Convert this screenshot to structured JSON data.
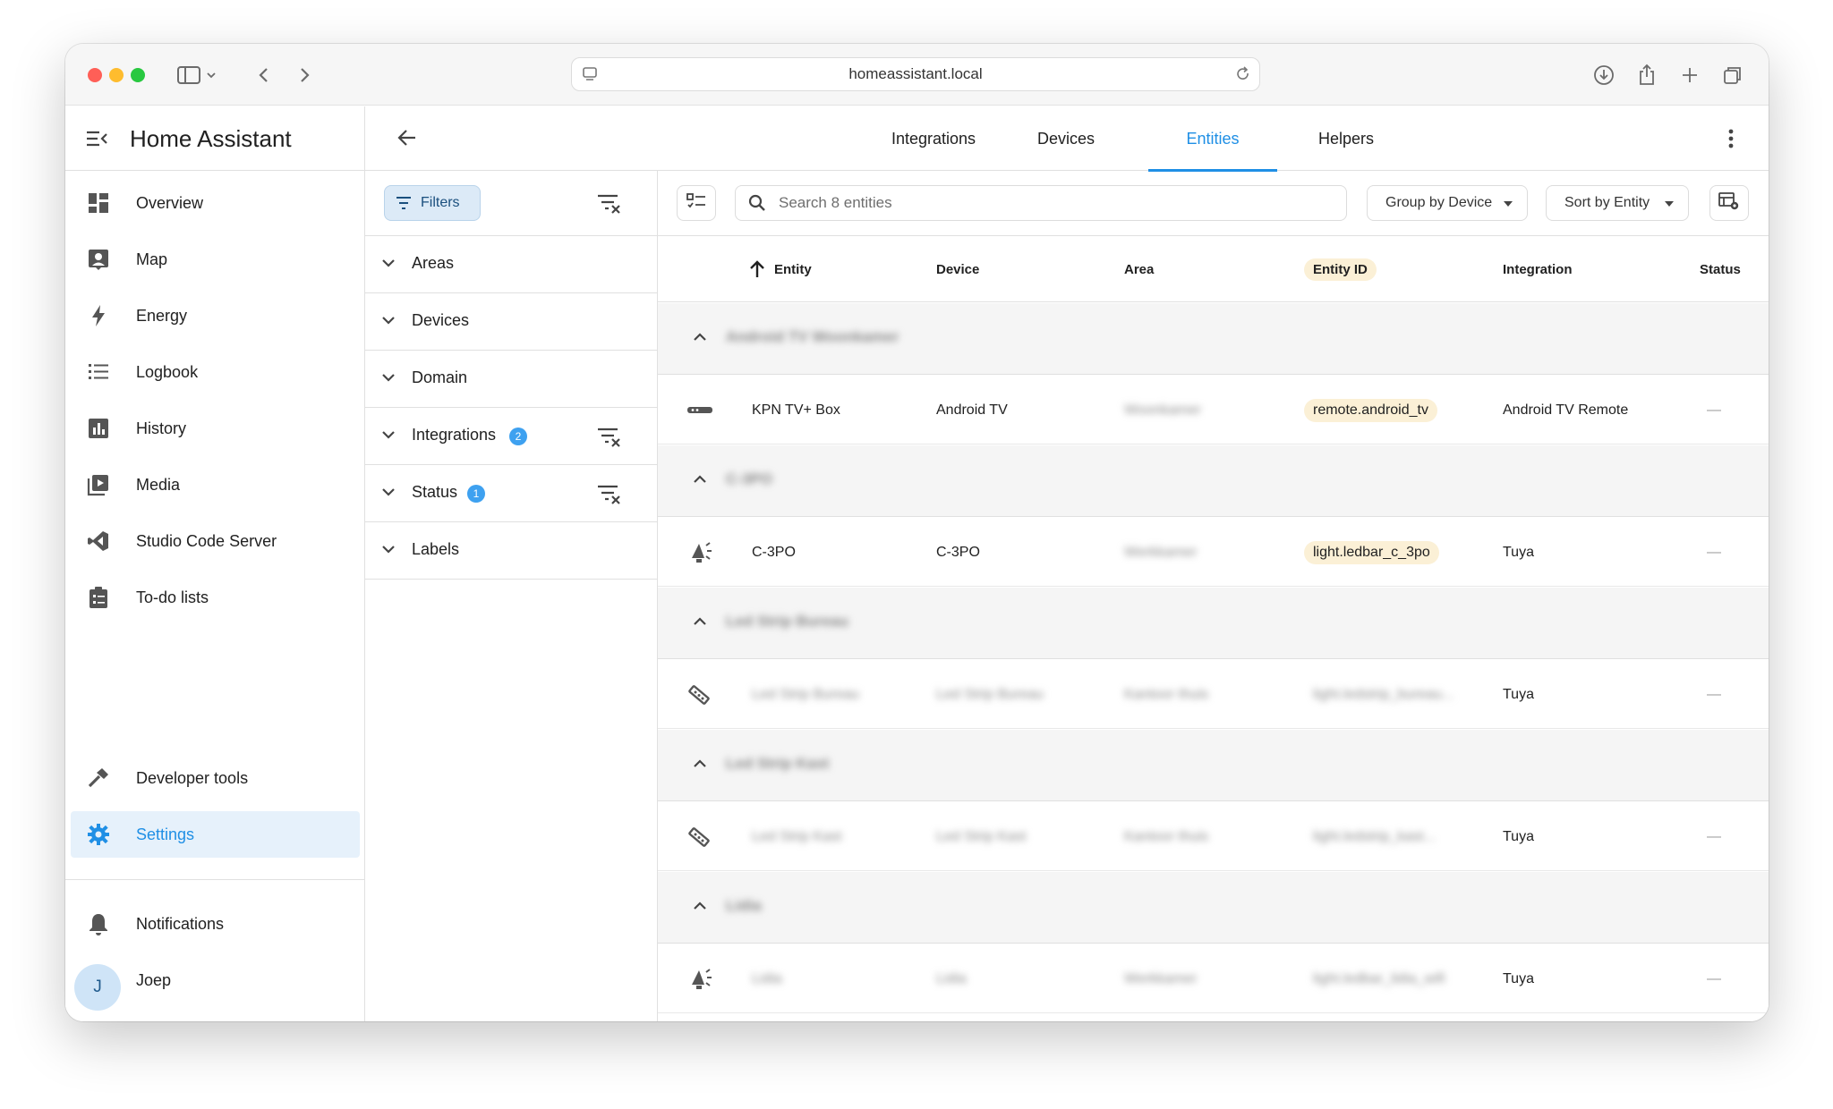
{
  "browser": {
    "url": "homeassistant.local"
  },
  "sidebar": {
    "title": "Home Assistant",
    "items": [
      {
        "label": "Overview",
        "icon": "overview-icon"
      },
      {
        "label": "Map",
        "icon": "map-icon"
      },
      {
        "label": "Energy",
        "icon": "energy-icon"
      },
      {
        "label": "Logbook",
        "icon": "logbook-icon"
      },
      {
        "label": "History",
        "icon": "history-icon"
      },
      {
        "label": "Media",
        "icon": "media-icon"
      },
      {
        "label": "Studio Code Server",
        "icon": "vscode-icon"
      },
      {
        "label": "To-do lists",
        "icon": "todo-icon"
      }
    ],
    "developer_tools": "Developer tools",
    "settings": "Settings",
    "notifications": "Notifications",
    "user": {
      "initial": "J",
      "name": "Joep"
    }
  },
  "tabs": {
    "integrations": "Integrations",
    "devices": "Devices",
    "entities": "Entities",
    "helpers": "Helpers",
    "active": "Entities"
  },
  "filters": {
    "button_label": "Filters",
    "sections": [
      {
        "label": "Areas",
        "badge": null
      },
      {
        "label": "Devices",
        "badge": null
      },
      {
        "label": "Domain",
        "badge": null
      },
      {
        "label": "Integrations",
        "badge": "2"
      },
      {
        "label": "Status",
        "badge": "1"
      },
      {
        "label": "Labels",
        "badge": null
      }
    ]
  },
  "toolbar": {
    "search_placeholder": "Search 8 entities",
    "group_by": "Group by Device",
    "sort_by": "Sort by Entity"
  },
  "table": {
    "columns": {
      "entity": "Entity",
      "device": "Device",
      "area": "Area",
      "entity_id": "Entity ID",
      "integration": "Integration",
      "status": "Status"
    },
    "groups": [
      {
        "title": "Android TV Woonkamer",
        "row": {
          "icon": "remote-icon",
          "entity": "KPN TV+ Box",
          "device": "Android TV",
          "area": "Woonkamer",
          "entity_id": "remote.android_tv",
          "integration": "Android TV Remote",
          "status": "—"
        }
      },
      {
        "title": "C-3PO",
        "row": {
          "icon": "lamp-icon",
          "entity": "C-3PO",
          "device": "C-3PO",
          "area": "Werkkamer",
          "entity_id": "light.ledbar_c_3po",
          "integration": "Tuya",
          "status": "—"
        }
      },
      {
        "title": "Led Strip Bureau",
        "row": {
          "icon": "led-strip-icon",
          "entity": "Led Strip Bureau",
          "device": "Led Strip Bureau",
          "area": "Kantoor thuis",
          "entity_id": "light.ledstrip_bureau...",
          "integration": "Tuya",
          "status": "—"
        }
      },
      {
        "title": "Led Strip Kast",
        "row": {
          "icon": "led-strip-icon",
          "entity": "Led Strip Kast",
          "device": "Led Strip Kast",
          "area": "Kantoor thuis",
          "entity_id": "light.ledstrip_kast...",
          "integration": "Tuya",
          "status": "—"
        }
      },
      {
        "title": "Lidia",
        "row": {
          "icon": "lamp-icon",
          "entity": "Lidia",
          "device": "Lidia",
          "area": "Werkkamer",
          "entity_id": "light.ledbar_lidia_wifi",
          "integration": "Tuya",
          "status": "—"
        }
      }
    ]
  }
}
